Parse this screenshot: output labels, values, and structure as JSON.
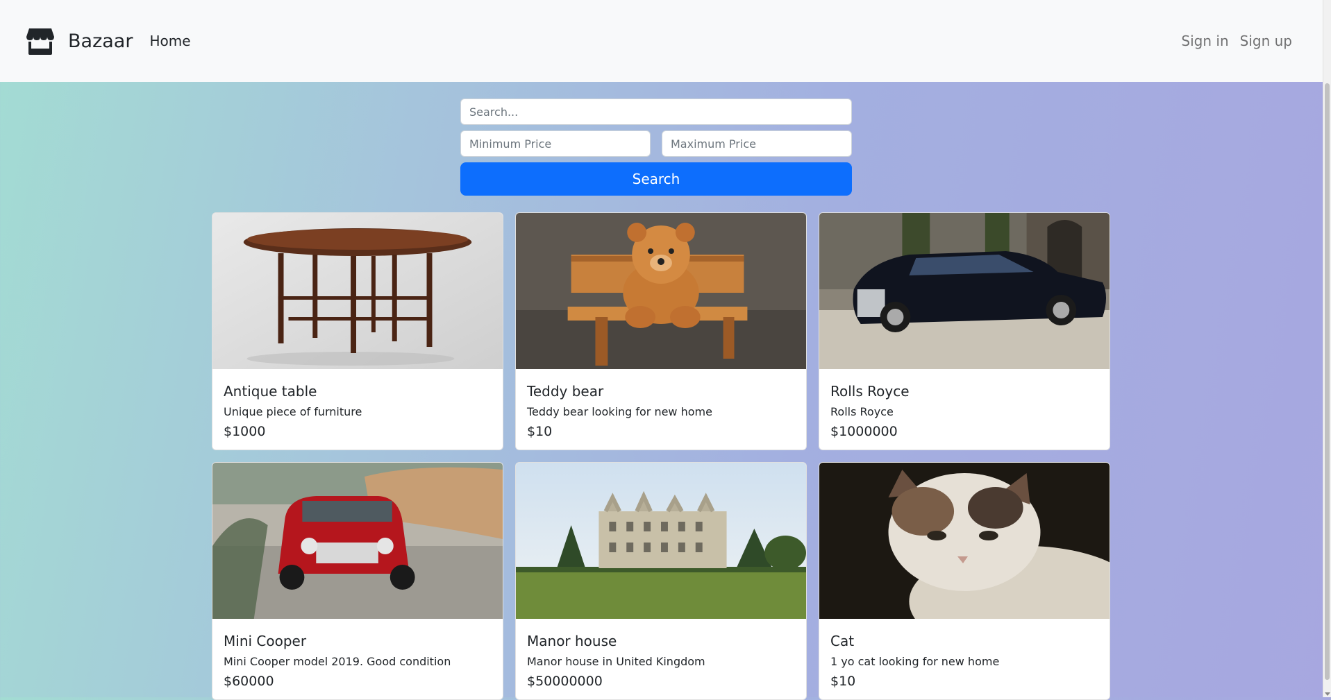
{
  "navbar": {
    "brand_name": "Bazaar",
    "brand_icon": "shop-icon",
    "home_label": "Home",
    "signin_label": "Sign in",
    "signup_label": "Sign up"
  },
  "search": {
    "query_placeholder": "Search...",
    "min_price_placeholder": "Minimum Price",
    "max_price_placeholder": "Maximum Price",
    "button_label": "Search",
    "button_color": "#0d6efd"
  },
  "listings": [
    {
      "title": "Antique table",
      "description": "Unique piece of furniture",
      "price": "$1000",
      "image": "antique-table-photo"
    },
    {
      "title": "Teddy bear",
      "description": "Teddy bear looking for new home",
      "price": "$10",
      "image": "teddy-bear-photo"
    },
    {
      "title": "Rolls Royce",
      "description": "Rolls Royce",
      "price": "$1000000",
      "image": "rolls-royce-photo"
    },
    {
      "title": "Mini Cooper",
      "description": "Mini Cooper model 2019. Good condition",
      "price": "$60000",
      "image": "mini-cooper-photo"
    },
    {
      "title": "Manor house",
      "description": "Manor house in United Kingdom",
      "price": "$50000000",
      "image": "manor-house-photo"
    },
    {
      "title": "Cat",
      "description": "1 yo cat looking for new home",
      "price": "$10",
      "image": "cat-photo"
    }
  ]
}
